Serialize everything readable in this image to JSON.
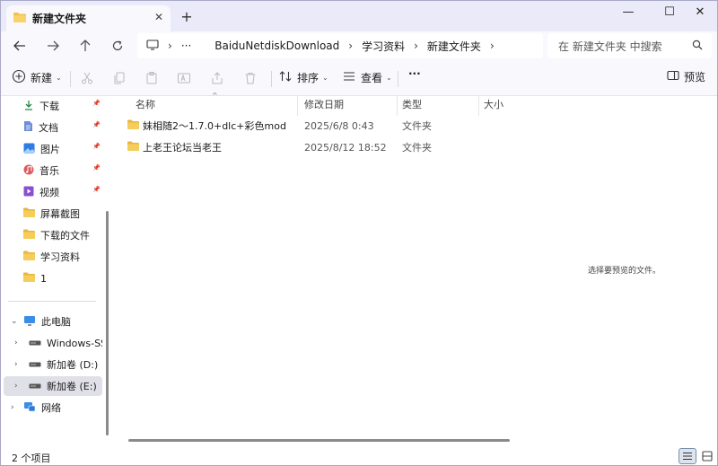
{
  "window": {
    "tab_title": "新建文件夹",
    "tab_close": "✕",
    "new_tab": "+",
    "minimize": "—",
    "maximize": "☐",
    "close": "✕"
  },
  "nav": {
    "breadcrumbs": [
      "BaiduNetdiskDownload",
      "学习资料",
      "新建文件夹"
    ],
    "more": "···",
    "search_placeholder": "在 新建文件夹 中搜索"
  },
  "commands": {
    "new": "新建",
    "sort": "排序",
    "view": "查看",
    "more": "···",
    "preview": "预览"
  },
  "sidebar": {
    "quick_access": [
      {
        "label": "下载",
        "icon": "download-icon",
        "pinned": true
      },
      {
        "label": "文档",
        "icon": "document-icon",
        "pinned": true
      },
      {
        "label": "图片",
        "icon": "pictures-icon",
        "pinned": true
      },
      {
        "label": "音乐",
        "icon": "music-icon",
        "pinned": true
      },
      {
        "label": "视频",
        "icon": "video-icon",
        "pinned": true
      },
      {
        "label": "屏幕截图",
        "icon": "folder-icon",
        "pinned": false
      },
      {
        "label": "下载的文件",
        "icon": "folder-icon",
        "pinned": false
      },
      {
        "label": "学习资料",
        "icon": "folder-icon",
        "pinned": false
      },
      {
        "label": "1",
        "icon": "folder-icon",
        "pinned": false
      }
    ],
    "this_pc": "此电脑",
    "drives": [
      {
        "label": "Windows-SSD",
        "icon": "drive-icon"
      },
      {
        "label": "新加卷 (D:)",
        "icon": "drive-icon"
      },
      {
        "label": "新加卷 (E:)",
        "icon": "drive-icon",
        "selected": true
      }
    ],
    "network": "网络"
  },
  "filelist": {
    "columns": [
      "名称",
      "修改日期",
      "类型",
      "大小"
    ],
    "rows": [
      {
        "name": "妹相随2～1.7.0+dlc+彩色mod",
        "date": "2025/6/8 0:43",
        "type": "文件夹"
      },
      {
        "name": "上老王论坛当老王",
        "date": "2025/8/12 18:52",
        "type": "文件夹"
      }
    ]
  },
  "preview": {
    "message": "选择要预览的文件。"
  },
  "status": {
    "item_count": "2 个项目"
  },
  "colors": {
    "folder": "#f0c24b",
    "titlebar_bg": "#eaeaf8",
    "toolbar_bg": "#f9f9fd",
    "accent": "#0067c0"
  }
}
